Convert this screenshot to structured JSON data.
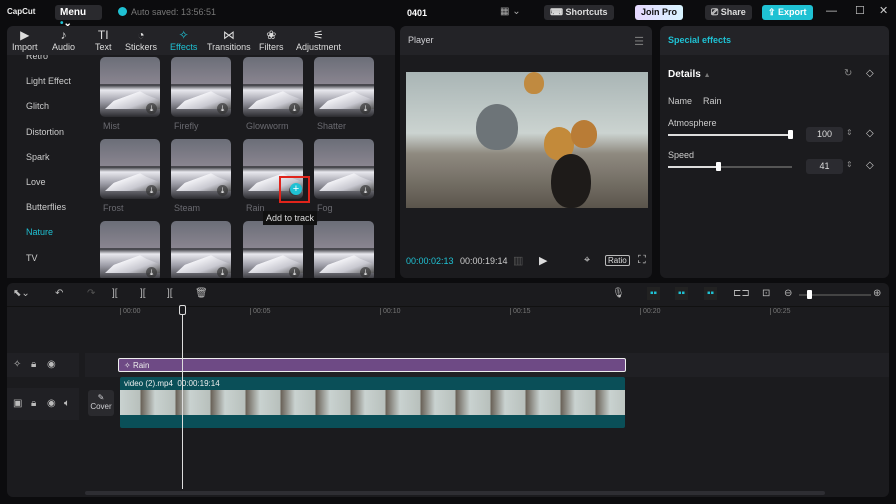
{
  "app": {
    "logo": "CapCut",
    "menu": "Menu",
    "autosave": "Auto saved: 13:56:51",
    "project": "0401",
    "shortcuts": "Shortcuts",
    "join_pro": "Join Pro",
    "share": "Share",
    "export": "Export",
    "accent": "#1fc1d3"
  },
  "tabs": [
    {
      "label": "Import",
      "icon": "import-icon"
    },
    {
      "label": "Audio",
      "icon": "audio-icon"
    },
    {
      "label": "Text",
      "icon": "text-icon"
    },
    {
      "label": "Stickers",
      "icon": "stickers-icon"
    },
    {
      "label": "Effects",
      "icon": "effects-icon",
      "active": true
    },
    {
      "label": "Transitions",
      "icon": "transitions-icon"
    },
    {
      "label": "Filters",
      "icon": "filters-icon"
    },
    {
      "label": "Adjustment",
      "icon": "adjustment-icon"
    }
  ],
  "categories": [
    "Retro",
    "Light Effect",
    "Glitch",
    "Distortion",
    "Spark",
    "Love",
    "Butterflies",
    "Nature",
    "TV"
  ],
  "active_category": "Nature",
  "effects": [
    "Mist",
    "Firefly",
    "Glowworm",
    "Shatter",
    "Frost",
    "Steam",
    "Rain",
    "Fog",
    "",
    "",
    "",
    ""
  ],
  "tooltip": "Add to track",
  "player": {
    "title": "Player",
    "current": "00:00:02:13",
    "total": "00:00:19:14",
    "ratio": "Ratio"
  },
  "inspector": {
    "title": "Special effects",
    "details": "Details",
    "name_label": "Name",
    "name_value": "Rain",
    "atmosphere_label": "Atmosphere",
    "atmosphere": "100",
    "speed_label": "Speed",
    "speed": "41"
  },
  "timeline": {
    "ticks": [
      "00:00",
      "00:05",
      "00:10",
      "00:15",
      "00:20",
      "00:25"
    ],
    "effect_clip": "Rain",
    "video_clip": "video (2).mp4",
    "video_duration": "00:00:19:14",
    "cover": "Cover"
  }
}
